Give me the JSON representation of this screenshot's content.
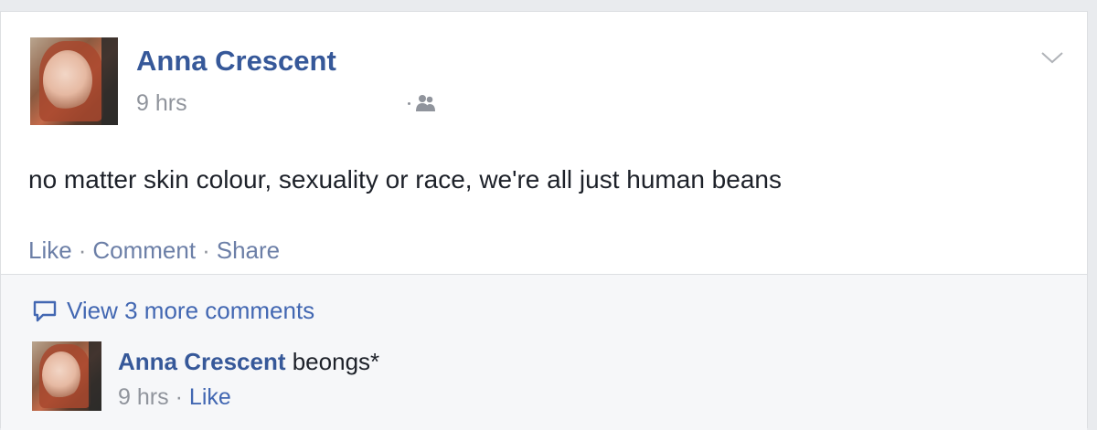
{
  "post": {
    "author": "Anna Crescent",
    "timestamp": "9 hrs",
    "audience_icon": "friends-icon",
    "menu_icon": "chevron-down-icon",
    "text": "no matter skin colour, sexuality or race, we're all just human beans",
    "actions": {
      "like": "Like",
      "comment": "Comment",
      "share": "Share",
      "separator": "·"
    }
  },
  "comments": {
    "view_more_label": "View 3 more comments",
    "view_more_icon": "comment-bubble-icon",
    "items": [
      {
        "author": "Anna Crescent",
        "text": " beongs*",
        "timestamp": "9 hrs",
        "like_label": "Like",
        "separator": "·"
      }
    ]
  },
  "colors": {
    "link_blue": "#365899",
    "meta_gray": "#90949c",
    "text": "#1d2129",
    "background": "#e9ebee",
    "comment_bg": "#f6f7f9"
  }
}
